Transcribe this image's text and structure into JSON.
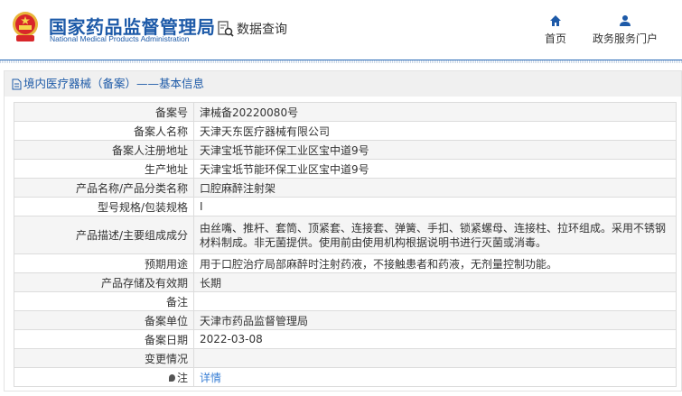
{
  "header": {
    "brand_cn": "国家药品监督管理局",
    "brand_en": "National Medical Products Administration",
    "data_query": "数据查询",
    "nav": [
      {
        "label": "首页",
        "icon": "home-icon"
      },
      {
        "label": "政务服务门户",
        "icon": "user-icon"
      }
    ]
  },
  "panel": {
    "title": "境内医疗器械（备案）——基本信息"
  },
  "rows": [
    {
      "label": "备案号",
      "value": "津械备20220080号"
    },
    {
      "label": "备案人名称",
      "value": "天津天东医疗器械有限公司"
    },
    {
      "label": "备案人注册地址",
      "value": "天津宝坻节能环保工业区宝中道9号"
    },
    {
      "label": "生产地址",
      "value": "天津宝坻节能环保工业区宝中道9号"
    },
    {
      "label": "产品名称/产品分类名称",
      "value": "口腔麻醉注射架"
    },
    {
      "label": "型号规格/包装规格",
      "value": "I"
    },
    {
      "label": "产品描述/主要组成成分",
      "value": "由丝嘴、推杆、套筒、顶紧套、连接套、弹簧、手扣、锁紧螺母、连接柱、拉环组成。采用不锈钢材料制成。非无菌提供。使用前由使用机构根据说明书进行灭菌或消毒。"
    },
    {
      "label": "预期用途",
      "value": "用于口腔治疗局部麻醉时注射药液，不接触患者和药液，无剂量控制功能。"
    },
    {
      "label": "产品存储及有效期",
      "value": "长期"
    },
    {
      "label": "备注",
      "value": ""
    },
    {
      "label": "备案单位",
      "value": "天津市药品监督管理局"
    },
    {
      "label": "备案日期",
      "value": "2022-03-08"
    },
    {
      "label": "变更情况",
      "value": ""
    },
    {
      "label": "注",
      "value": "详情"
    }
  ]
}
